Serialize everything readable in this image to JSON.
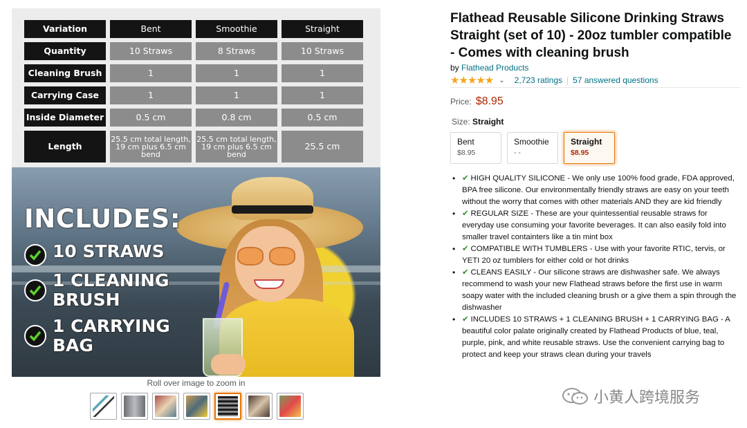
{
  "spec_table": {
    "headers": [
      "Variation",
      "Bent",
      "Smoothie",
      "Straight"
    ],
    "rows": [
      {
        "label": "Quantity",
        "values": [
          "10 Straws",
          "8 Straws",
          "10 Straws"
        ]
      },
      {
        "label": "Cleaning Brush",
        "values": [
          "1",
          "1",
          "1"
        ]
      },
      {
        "label": "Carrying Case",
        "values": [
          "1",
          "1",
          "1"
        ]
      },
      {
        "label": "Inside Diameter",
        "values": [
          "0.5 cm",
          "0.8 cm",
          "0.5 cm"
        ]
      },
      {
        "label": "Length",
        "values": [
          "25.5 cm total length, 19 cm plus 6.5 cm bend",
          "25.5 cm total length, 19 cm plus 6.5 cm bend",
          "25.5 cm"
        ]
      }
    ]
  },
  "includes": {
    "heading": "INCLUDES:",
    "items": [
      "10 STRAWS",
      "1 CLEANING BRUSH",
      "1 CARRYING BAG"
    ]
  },
  "zoom_hint": "Roll over image to zoom in",
  "thumbnails": [
    {
      "color": "#5aa7b6",
      "active": false
    },
    {
      "color": "#6d6f73",
      "active": false
    },
    {
      "color": "#a94f4a",
      "active": false
    },
    {
      "color": "#c79b55",
      "active": false
    },
    {
      "color": "#8c8c8c",
      "active": true
    },
    {
      "color": "#4a3b33",
      "active": false
    },
    {
      "color": "#7a9b5f",
      "active": false
    }
  ],
  "product": {
    "title": "Flathead Reusable Silicone Drinking Straws Straight (set of 10) - 20oz tumbler compatible - Comes with cleaning brush",
    "by_prefix": "by ",
    "brand": "Flathead Products",
    "stars": "★★★★★",
    "ratings": "2,723 ratings",
    "separator": "|",
    "questions": "57 answered questions",
    "price_label": "Price:",
    "price": "$8.95",
    "size_label": "Size:",
    "size_value": "Straight",
    "variants": [
      {
        "name": "Bent",
        "price": "$8.95",
        "selected": false
      },
      {
        "name": "Smoothie",
        "price": "- -",
        "selected": false
      },
      {
        "name": "Straight",
        "price": "$8.95",
        "selected": true
      }
    ],
    "bullets": [
      "HIGH QUALITY SILICONE - We only use 100% food grade, FDA approved, BPA free silicone. Our environmentally friendly straws are easy on your teeth without the worry that comes with other materials AND they are kid friendly",
      "REGULAR SIZE - These are your quintessential reusable straws for everyday use consuming your favorite beverages. It can also easily fold into smaller travel containters like a tin mint box",
      "COMPATIBLE WITH TUMBLERS - Use with your favorite RTIC, tervis, or YETI 20 oz tumblers for either cold or hot drinks",
      "CLEANS EASILY - Our silicone straws are dishwasher safe. We always recommend to wash your new Flathead straws before the first use in warm soapy water with the included cleaning brush or a give them a spin through the dishwasher",
      "INCLUDES 10 STRAWS + 1 CLEANING BRUSH + 1 CARRYING BAG - A beautiful color palate originally created by Flathead Products of blue, teal, purple, pink, and white reusable straws. Use the convenient carrying bag to protect and keep your straws clean during your travels"
    ],
    "check_glyph": "✔"
  },
  "watermark": {
    "text": "小黄人跨境服务",
    "icon": "wechat-icon"
  },
  "colors": {
    "price": "#b12704",
    "link": "#007185",
    "star": "#f5a41b",
    "selected_border": "#e77600",
    "check": "#2e8b2e"
  }
}
